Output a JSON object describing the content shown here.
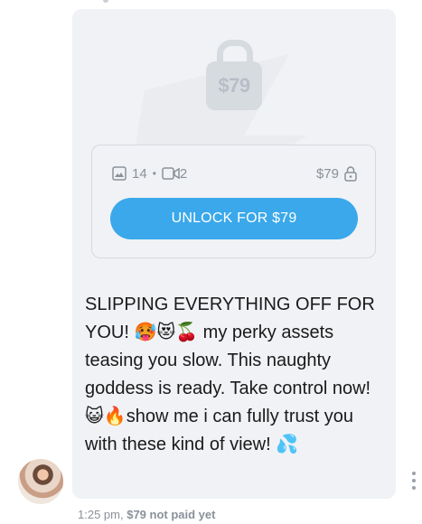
{
  "media": {
    "lock_price": "$79",
    "photo_count": "14",
    "separator": "•",
    "video_count": "2",
    "price": "$79",
    "unlock_label": "UNLOCK FOR $79",
    "icons": {
      "lock": "lock-icon",
      "photo": "image-icon",
      "video": "video-icon",
      "small_lock": "lock-small-icon"
    }
  },
  "message": {
    "text": "SLIPPING EVERYTHING OFF FOR YOU! 🥵😻🍒 my perky assets teasing you slow. This naughty goddess is ready. Take control now! 😺🔥show me i can fully trust you with these kind of view! 💦"
  },
  "meta": {
    "time": "1:25 pm,",
    "status": "$79 not paid yet"
  },
  "colors": {
    "bubble": "#f0f2f5",
    "accent": "#3aa8ea",
    "muted": "#8a9199"
  }
}
